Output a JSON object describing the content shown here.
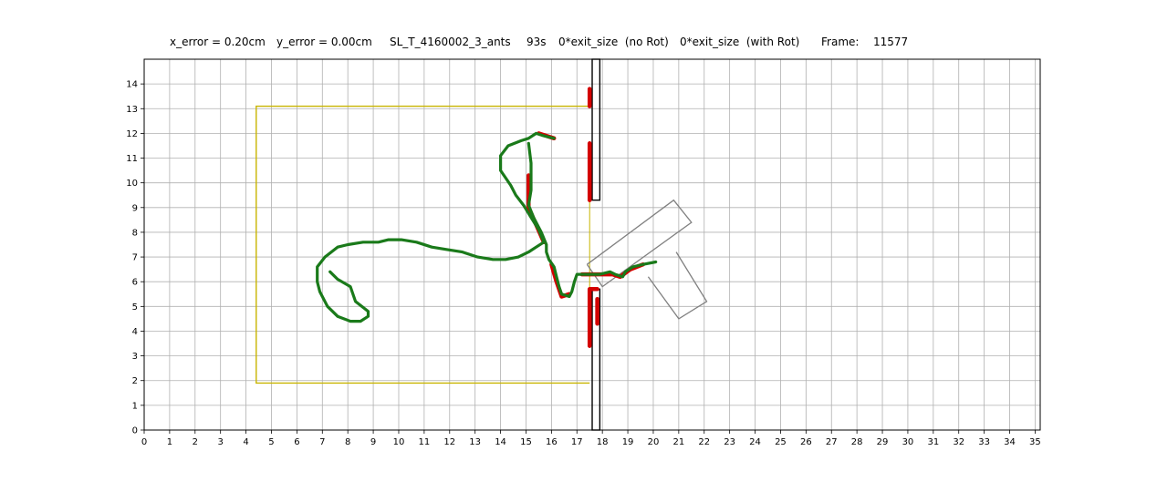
{
  "header": {
    "x_error": "x_error = 0.20cm",
    "y_error": "y_error = 0.00cm",
    "experiment": "SL_T_4160002_3_ants",
    "time": "93s",
    "exit_no_rot": "0*exit_size  (no Rot)",
    "exit_with_rot": "0*exit_size  (with Rot)",
    "frame_label": "Frame:",
    "frame_value": "11577"
  },
  "colors": {
    "grid": "#b0b0b0",
    "arena": "#c8b400",
    "walls": "#000000",
    "contacts": "#d40000",
    "trajectory": "#1a7a1a",
    "load": "#808080"
  },
  "chart_data": {
    "type": "line",
    "xlim": [
      0,
      35.2
    ],
    "ylim": [
      0,
      15
    ],
    "x_ticks": [
      0,
      1,
      2,
      3,
      4,
      5,
      6,
      7,
      8,
      9,
      10,
      11,
      12,
      13,
      14,
      15,
      16,
      17,
      18,
      19,
      20,
      21,
      22,
      23,
      24,
      25,
      26,
      27,
      28,
      29,
      30,
      31,
      32,
      33,
      34,
      35
    ],
    "y_ticks": [
      0,
      1,
      2,
      3,
      4,
      5,
      6,
      7,
      8,
      9,
      10,
      11,
      12,
      13,
      14
    ],
    "grid": true,
    "arena_rect": {
      "x0": 4.4,
      "y0": 1.9,
      "x1": 17.5,
      "y1": 13.1
    },
    "wall_top": {
      "x0": 17.6,
      "x1": 17.9,
      "y0": 9.3,
      "y1": 15
    },
    "wall_bottom": {
      "x0": 17.6,
      "x1": 17.9,
      "y0": 0,
      "y1": 5.7
    },
    "load_shape": [
      [
        [
          17.4,
          6.7
        ],
        [
          20.8,
          9.3
        ],
        [
          21.5,
          8.4
        ],
        [
          18.0,
          5.8
        ],
        [
          17.4,
          6.7
        ]
      ],
      [
        [
          19.8,
          6.2
        ],
        [
          21.0,
          4.5
        ],
        [
          22.1,
          5.2
        ],
        [
          20.9,
          7.2
        ]
      ]
    ],
    "contact_points": [
      [
        [
          17.5,
          13.8
        ],
        [
          17.5,
          13.1
        ]
      ],
      [
        [
          17.5,
          11.6
        ],
        [
          17.5,
          9.3
        ]
      ],
      [
        [
          17.5,
          3.4
        ],
        [
          17.5,
          5.7
        ],
        [
          17.8,
          5.7
        ]
      ],
      [
        [
          17.8,
          5.3
        ],
        [
          17.8,
          4.3
        ]
      ],
      [
        [
          15.5,
          12.0
        ],
        [
          15.8,
          11.9
        ],
        [
          16.1,
          11.8
        ]
      ],
      [
        [
          15.1,
          10.3
        ],
        [
          15.1,
          9.0
        ],
        [
          15.7,
          7.6
        ]
      ],
      [
        [
          16.0,
          6.7
        ],
        [
          16.2,
          6.0
        ],
        [
          16.4,
          5.4
        ],
        [
          16.7,
          5.5
        ]
      ],
      [
        [
          17.2,
          6.3
        ],
        [
          18.4,
          6.3
        ],
        [
          18.7,
          6.2
        ],
        [
          19.1,
          6.5
        ],
        [
          19.6,
          6.7
        ]
      ]
    ],
    "series": [
      {
        "values": [
          [
            7.3,
            6.4
          ],
          [
            7.6,
            6.1
          ],
          [
            8.1,
            5.8
          ],
          [
            8.3,
            5.2
          ],
          [
            8.8,
            4.8
          ],
          [
            8.8,
            4.6
          ],
          [
            8.5,
            4.4
          ],
          [
            8.1,
            4.4
          ],
          [
            7.6,
            4.6
          ],
          [
            7.2,
            5.0
          ],
          [
            6.9,
            5.6
          ],
          [
            6.8,
            6.0
          ],
          [
            6.8,
            6.6
          ],
          [
            7.1,
            7.0
          ],
          [
            7.6,
            7.4
          ],
          [
            8.0,
            7.5
          ],
          [
            8.6,
            7.6
          ],
          [
            9.2,
            7.6
          ],
          [
            9.6,
            7.7
          ],
          [
            10.1,
            7.7
          ],
          [
            10.7,
            7.6
          ],
          [
            11.3,
            7.4
          ],
          [
            11.9,
            7.3
          ],
          [
            12.5,
            7.2
          ],
          [
            13.1,
            7.0
          ],
          [
            13.7,
            6.9
          ],
          [
            14.2,
            6.9
          ],
          [
            14.7,
            7.0
          ],
          [
            15.1,
            7.2
          ],
          [
            15.4,
            7.4
          ],
          [
            15.7,
            7.6
          ],
          [
            15.5,
            8.1
          ],
          [
            15.2,
            8.6
          ],
          [
            14.9,
            9.1
          ],
          [
            14.6,
            9.5
          ],
          [
            14.4,
            9.9
          ],
          [
            14.0,
            10.5
          ],
          [
            14.0,
            11.1
          ],
          [
            14.3,
            11.5
          ],
          [
            14.8,
            11.7
          ],
          [
            15.1,
            11.8
          ],
          [
            15.4,
            12.0
          ],
          [
            15.7,
            11.9
          ],
          [
            16.1,
            11.8
          ]
        ]
      },
      {
        "values": [
          [
            15.1,
            11.6
          ],
          [
            15.2,
            10.8
          ],
          [
            15.2,
            9.7
          ],
          [
            15.1,
            9.1
          ],
          [
            15.3,
            8.6
          ],
          [
            15.6,
            8.0
          ],
          [
            15.8,
            7.5
          ],
          [
            15.8,
            7.2
          ],
          [
            15.9,
            6.9
          ],
          [
            16.1,
            6.6
          ],
          [
            16.2,
            6.2
          ],
          [
            16.3,
            5.8
          ],
          [
            16.4,
            5.5
          ],
          [
            16.7,
            5.4
          ],
          [
            16.8,
            5.6
          ],
          [
            16.9,
            6.0
          ],
          [
            17.0,
            6.3
          ],
          [
            17.4,
            6.3
          ],
          [
            17.9,
            6.3
          ],
          [
            18.3,
            6.4
          ],
          [
            18.5,
            6.3
          ],
          [
            18.8,
            6.2
          ],
          [
            18.9,
            6.4
          ],
          [
            19.2,
            6.6
          ],
          [
            19.6,
            6.7
          ],
          [
            20.1,
            6.8
          ]
        ]
      }
    ]
  }
}
